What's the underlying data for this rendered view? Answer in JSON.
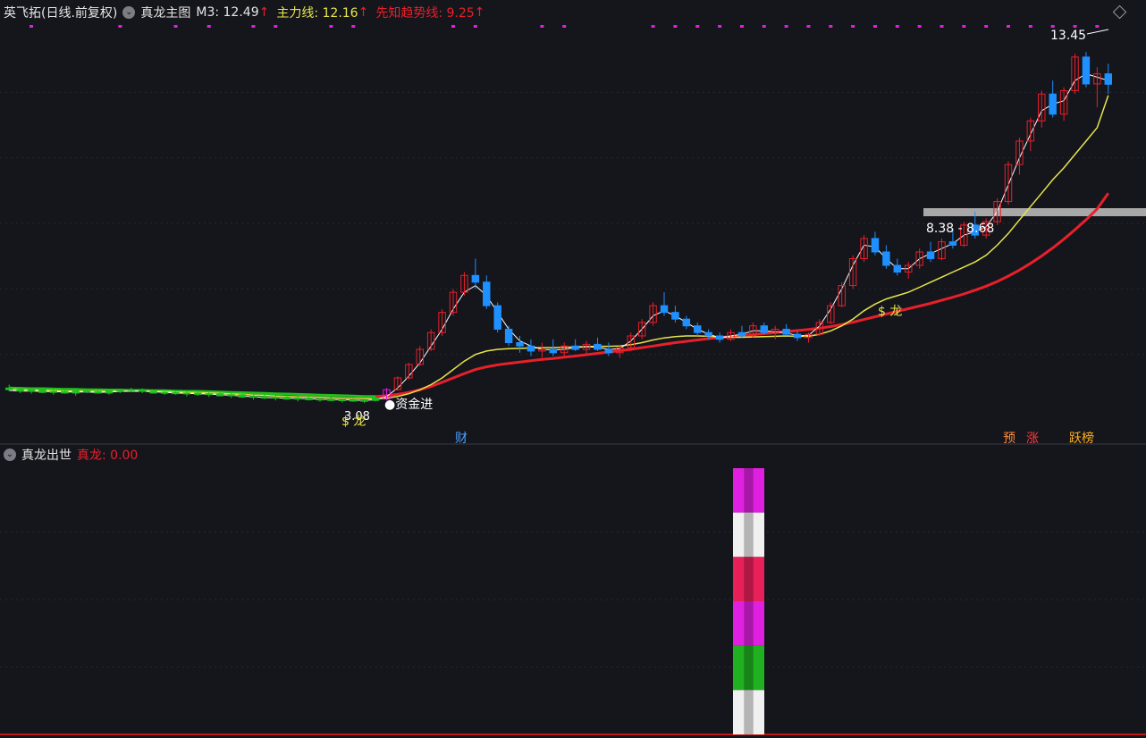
{
  "header": {
    "stock": "英飞拓(日线.前复权)",
    "indicator_name": "真龙主图",
    "m3_label": "M3: 12.49",
    "zhuli_label": "主力线: 12.16",
    "xianzhi_label": "先知趋势线: 9.25"
  },
  "sub_header": {
    "indicator_name": "真龙出世",
    "value_label": "真龙: 0.00"
  },
  "colors": {
    "background": "#15151c",
    "up": "#e8202a",
    "down": "#1e90ff",
    "green": "#20c020",
    "yellow": "#e6e64a",
    "magenta": "#e020e0",
    "pink": "#ff3a70",
    "white": "#ffffff",
    "grid": "#262630"
  },
  "annotations": {
    "high_label": "13.45",
    "low_label": "3.08",
    "dragon_label": "$ 龙",
    "dragon_label_2": "$ 龙",
    "capital_in": "●资金进",
    "range_label": "8.38 - 8.68",
    "cai": "财",
    "yu": "预",
    "zhang": "涨",
    "yb": "跃榜"
  },
  "chart_data": {
    "type": "candlestick",
    "title": "真龙主图",
    "ylim": [
      2.5,
      14.2
    ],
    "candles": [
      [
        3.45,
        3.55,
        3.35,
        3.4
      ],
      [
        3.4,
        3.48,
        3.3,
        3.36
      ],
      [
        3.36,
        3.42,
        3.28,
        3.4
      ],
      [
        3.4,
        3.45,
        3.3,
        3.32
      ],
      [
        3.32,
        3.4,
        3.25,
        3.35
      ],
      [
        3.35,
        3.42,
        3.28,
        3.3
      ],
      [
        3.3,
        3.38,
        3.22,
        3.36
      ],
      [
        3.36,
        3.42,
        3.3,
        3.34
      ],
      [
        3.34,
        3.4,
        3.28,
        3.3
      ],
      [
        3.3,
        3.38,
        3.25,
        3.36
      ],
      [
        3.36,
        3.42,
        3.3,
        3.4
      ],
      [
        3.4,
        3.46,
        3.34,
        3.38
      ],
      [
        3.38,
        3.44,
        3.3,
        3.35
      ],
      [
        3.35,
        3.4,
        3.28,
        3.3
      ],
      [
        3.3,
        3.36,
        3.24,
        3.32
      ],
      [
        3.32,
        3.38,
        3.25,
        3.28
      ],
      [
        3.28,
        3.35,
        3.2,
        3.3
      ],
      [
        3.3,
        3.36,
        3.22,
        3.26
      ],
      [
        3.26,
        3.32,
        3.18,
        3.28
      ],
      [
        3.28,
        3.34,
        3.2,
        3.22
      ],
      [
        3.22,
        3.3,
        3.15,
        3.25
      ],
      [
        3.25,
        3.3,
        3.15,
        3.18
      ],
      [
        3.18,
        3.25,
        3.1,
        3.2
      ],
      [
        3.2,
        3.26,
        3.12,
        3.15
      ],
      [
        3.15,
        3.22,
        3.08,
        3.18
      ],
      [
        3.18,
        3.24,
        3.1,
        3.12
      ],
      [
        3.12,
        3.2,
        3.05,
        3.15
      ],
      [
        3.15,
        3.22,
        3.08,
        3.1
      ],
      [
        3.1,
        3.16,
        3.04,
        3.12
      ],
      [
        3.12,
        3.18,
        3.06,
        3.08
      ],
      [
        3.08,
        3.14,
        3.02,
        3.1
      ],
      [
        3.1,
        3.15,
        3.04,
        3.06
      ],
      [
        3.06,
        3.12,
        3.0,
        3.08
      ],
      [
        3.08,
        3.2,
        3.05,
        3.15
      ],
      [
        3.12,
        3.45,
        3.08,
        3.4
      ],
      [
        3.4,
        3.8,
        3.38,
        3.75
      ],
      [
        3.75,
        4.2,
        3.7,
        4.15
      ],
      [
        4.15,
        4.7,
        4.1,
        4.6
      ],
      [
        4.6,
        5.2,
        4.55,
        5.1
      ],
      [
        5.1,
        5.8,
        5.0,
        5.7
      ],
      [
        5.7,
        6.4,
        5.6,
        6.3
      ],
      [
        6.3,
        6.9,
        6.2,
        6.8
      ],
      [
        6.8,
        7.3,
        6.4,
        6.6
      ],
      [
        6.6,
        6.8,
        5.8,
        5.9
      ],
      [
        5.9,
        6.0,
        5.1,
        5.2
      ],
      [
        5.2,
        5.3,
        4.7,
        4.8
      ],
      [
        4.8,
        5.0,
        4.5,
        4.7
      ],
      [
        4.7,
        4.9,
        4.4,
        4.55
      ],
      [
        4.55,
        4.8,
        4.35,
        4.6
      ],
      [
        4.6,
        4.9,
        4.4,
        4.5
      ],
      [
        4.5,
        4.8,
        4.4,
        4.7
      ],
      [
        4.7,
        4.9,
        4.55,
        4.6
      ],
      [
        4.6,
        4.85,
        4.45,
        4.75
      ],
      [
        4.75,
        4.95,
        4.55,
        4.6
      ],
      [
        4.6,
        4.8,
        4.4,
        4.5
      ],
      [
        4.5,
        4.7,
        4.35,
        4.65
      ],
      [
        4.65,
        5.1,
        4.55,
        5.0
      ],
      [
        5.0,
        5.5,
        4.9,
        5.4
      ],
      [
        5.4,
        6.0,
        5.3,
        5.9
      ],
      [
        5.9,
        6.3,
        5.6,
        5.7
      ],
      [
        5.7,
        5.9,
        5.4,
        5.5
      ],
      [
        5.5,
        5.6,
        5.2,
        5.3
      ],
      [
        5.3,
        5.4,
        5.0,
        5.1
      ],
      [
        5.1,
        5.2,
        4.9,
        5.0
      ],
      [
        5.0,
        5.1,
        4.8,
        4.9
      ],
      [
        4.9,
        5.2,
        4.85,
        5.1
      ],
      [
        5.1,
        5.3,
        4.95,
        5.0
      ],
      [
        5.0,
        5.4,
        4.95,
        5.3
      ],
      [
        5.3,
        5.4,
        5.05,
        5.1
      ],
      [
        5.1,
        5.3,
        4.9,
        5.2
      ],
      [
        5.2,
        5.35,
        5.0,
        5.05
      ],
      [
        5.05,
        5.15,
        4.85,
        4.95
      ],
      [
        4.95,
        5.1,
        4.8,
        5.05
      ],
      [
        5.05,
        5.5,
        5.0,
        5.4
      ],
      [
        5.4,
        6.0,
        5.35,
        5.9
      ],
      [
        5.9,
        6.6,
        5.85,
        6.5
      ],
      [
        6.5,
        7.4,
        6.4,
        7.3
      ],
      [
        7.3,
        8.0,
        7.2,
        7.9
      ],
      [
        7.9,
        8.1,
        7.4,
        7.5
      ],
      [
        7.5,
        7.7,
        7.0,
        7.1
      ],
      [
        7.1,
        7.3,
        6.8,
        6.9
      ],
      [
        6.9,
        7.2,
        6.7,
        7.1
      ],
      [
        7.1,
        7.6,
        7.0,
        7.5
      ],
      [
        7.5,
        7.8,
        7.2,
        7.3
      ],
      [
        7.3,
        7.9,
        7.25,
        7.8
      ],
      [
        7.8,
        8.2,
        7.6,
        7.7
      ],
      [
        7.7,
        8.4,
        7.65,
        8.3
      ],
      [
        8.3,
        8.7,
        7.9,
        8.0
      ],
      [
        8.0,
        8.5,
        7.9,
        8.4
      ],
      [
        8.4,
        9.1,
        8.3,
        9.0
      ],
      [
        9.0,
        10.2,
        8.9,
        10.1
      ],
      [
        10.1,
        10.9,
        9.8,
        10.8
      ],
      [
        10.8,
        11.5,
        10.5,
        11.4
      ],
      [
        11.4,
        12.3,
        11.2,
        12.2
      ],
      [
        12.2,
        12.6,
        11.5,
        11.6
      ],
      [
        11.6,
        12.4,
        11.4,
        12.3
      ],
      [
        12.3,
        13.4,
        12.2,
        13.3
      ],
      [
        13.3,
        13.45,
        12.4,
        12.5
      ],
      [
        12.5,
        13.0,
        11.8,
        12.8
      ],
      [
        12.8,
        13.1,
        12.2,
        12.49
      ]
    ],
    "ma_white": [
      3.38,
      3.36,
      3.36,
      3.35,
      3.34,
      3.33,
      3.33,
      3.33,
      3.32,
      3.33,
      3.35,
      3.36,
      3.36,
      3.34,
      3.32,
      3.3,
      3.29,
      3.28,
      3.27,
      3.25,
      3.23,
      3.21,
      3.19,
      3.17,
      3.16,
      3.15,
      3.14,
      3.13,
      3.12,
      3.11,
      3.1,
      3.09,
      3.08,
      3.1,
      3.2,
      3.45,
      3.8,
      4.2,
      4.7,
      5.2,
      5.8,
      6.3,
      6.5,
      6.2,
      5.7,
      5.2,
      4.85,
      4.7,
      4.6,
      4.58,
      4.6,
      4.65,
      4.68,
      4.66,
      4.6,
      4.62,
      4.85,
      5.2,
      5.6,
      5.75,
      5.6,
      5.4,
      5.2,
      5.05,
      4.95,
      5.0,
      5.05,
      5.15,
      5.15,
      5.12,
      5.1,
      5.0,
      5.02,
      5.3,
      5.8,
      6.4,
      7.1,
      7.7,
      7.65,
      7.3,
      7.0,
      7.0,
      7.3,
      7.45,
      7.6,
      7.75,
      8.0,
      8.1,
      8.25,
      8.7,
      9.5,
      10.3,
      11.0,
      11.7,
      11.9,
      12.0,
      12.6,
      12.8,
      12.7,
      12.6
    ],
    "ma_yellow": [
      3.42,
      3.4,
      3.39,
      3.38,
      3.37,
      3.36,
      3.36,
      3.35,
      3.35,
      3.35,
      3.36,
      3.36,
      3.36,
      3.35,
      3.34,
      3.33,
      3.32,
      3.31,
      3.3,
      3.29,
      3.27,
      3.26,
      3.24,
      3.23,
      3.21,
      3.2,
      3.19,
      3.18,
      3.17,
      3.16,
      3.15,
      3.14,
      3.13,
      3.13,
      3.15,
      3.2,
      3.28,
      3.4,
      3.55,
      3.75,
      4.0,
      4.25,
      4.45,
      4.55,
      4.6,
      4.62,
      4.63,
      4.64,
      4.65,
      4.65,
      4.66,
      4.67,
      4.68,
      4.69,
      4.69,
      4.7,
      4.74,
      4.8,
      4.88,
      4.94,
      4.98,
      5.0,
      5.0,
      4.99,
      4.97,
      4.96,
      4.96,
      4.97,
      4.98,
      4.99,
      5.0,
      4.99,
      4.99,
      5.05,
      5.15,
      5.3,
      5.5,
      5.75,
      5.95,
      6.1,
      6.2,
      6.3,
      6.45,
      6.6,
      6.75,
      6.9,
      7.05,
      7.2,
      7.4,
      7.7,
      8.05,
      8.45,
      8.85,
      9.25,
      9.65,
      10.0,
      10.4,
      10.8,
      11.2,
      12.16
    ],
    "ma_red": [
      3.45,
      3.44,
      3.43,
      3.43,
      3.42,
      3.41,
      3.41,
      3.4,
      3.4,
      3.39,
      3.39,
      3.38,
      3.38,
      3.37,
      3.37,
      3.36,
      3.35,
      3.35,
      3.34,
      3.33,
      3.32,
      3.31,
      3.3,
      3.29,
      3.28,
      3.27,
      3.26,
      3.25,
      3.24,
      3.23,
      3.22,
      3.21,
      3.2,
      3.2,
      3.22,
      3.26,
      3.32,
      3.4,
      3.5,
      3.62,
      3.75,
      3.88,
      4.0,
      4.08,
      4.14,
      4.18,
      4.22,
      4.26,
      4.3,
      4.33,
      4.37,
      4.4,
      4.44,
      4.48,
      4.52,
      4.56,
      4.6,
      4.65,
      4.7,
      4.75,
      4.8,
      4.84,
      4.88,
      4.92,
      4.95,
      4.98,
      5.01,
      5.04,
      5.07,
      5.1,
      5.13,
      5.16,
      5.19,
      5.23,
      5.28,
      5.34,
      5.41,
      5.49,
      5.57,
      5.65,
      5.73,
      5.81,
      5.89,
      5.97,
      6.06,
      6.15,
      6.25,
      6.36,
      6.48,
      6.62,
      6.78,
      6.96,
      7.16,
      7.38,
      7.62,
      7.88,
      8.16,
      8.46,
      8.78,
      9.25
    ],
    "green_line_until": 33,
    "sub_bar": {
      "value": 0.0,
      "segments": [
        "magenta",
        "white",
        "pink",
        "magenta",
        "green",
        "white"
      ]
    },
    "range_band": [
      8.38,
      8.68
    ]
  }
}
